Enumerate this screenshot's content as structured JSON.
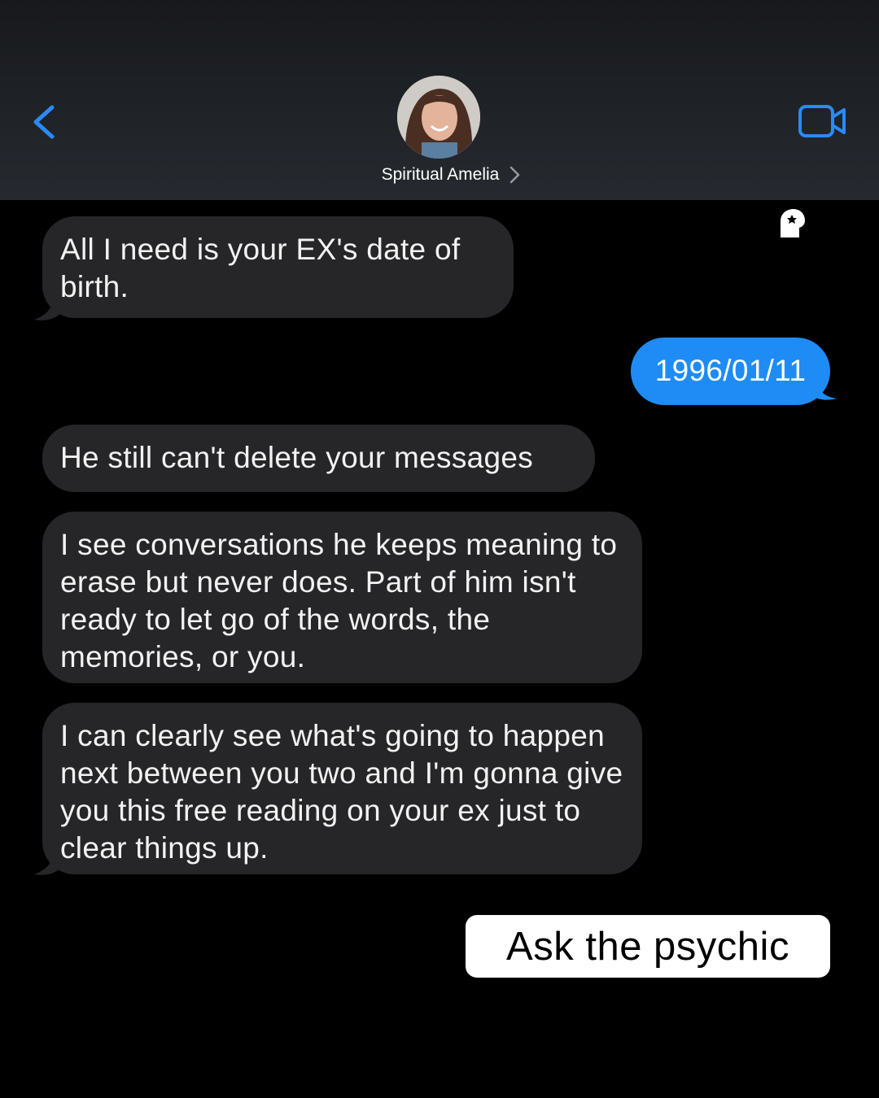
{
  "header": {
    "contact_name": "Spiritual Amelia",
    "back_icon": "chevron-left-icon",
    "video_icon": "video-camera-icon",
    "accent_color": "#2a8af6"
  },
  "messages": [
    {
      "direction": "incoming",
      "text": "All I need is your EX's date of birth."
    },
    {
      "direction": "outgoing",
      "text": "1996/01/11"
    },
    {
      "direction": "incoming",
      "text": "He still can't delete your messages"
    },
    {
      "direction": "incoming",
      "text": "I see conversations he keeps meaning to erase but never does. Part of him isn't ready to let go of the words, the memories, or you."
    },
    {
      "direction": "incoming",
      "text": "I can clearly see what's going to happen next between you two and I'm gonna give you this free reading on your ex just to clear things up."
    }
  ],
  "cta": {
    "label": "Ask the psychic"
  },
  "colors": {
    "incoming_bubble": "#262628",
    "outgoing_bubble": "#1e8cf4",
    "background": "#000000"
  }
}
